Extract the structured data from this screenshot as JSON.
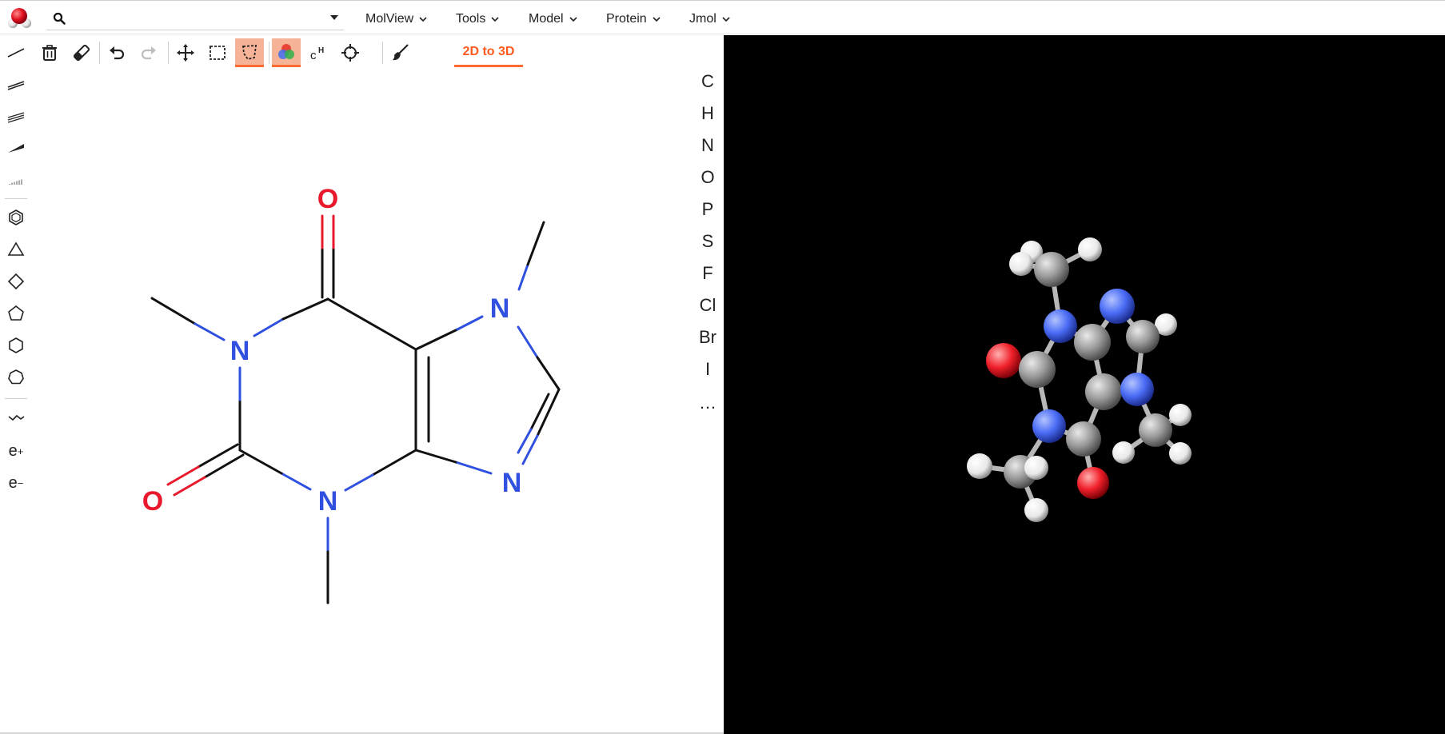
{
  "app": {
    "logo_icon": "molview-molecule-logo",
    "accent_color": "#ff5a1f"
  },
  "search": {
    "value": "",
    "placeholder": ""
  },
  "menus": [
    {
      "label": "MolView"
    },
    {
      "label": "Tools"
    },
    {
      "label": "Model"
    },
    {
      "label": "Protein"
    },
    {
      "label": "Jmol"
    }
  ],
  "toolbar": {
    "convert_label": "2D to 3D",
    "tools": [
      "trash-icon",
      "eraser-icon",
      "undo-icon",
      "redo-icon",
      "move-icon",
      "rect-select-icon",
      "lasso-select-icon",
      "color-mode-icon",
      "hydrogen-icon",
      "center-icon",
      "clean-icon"
    ],
    "active": [
      "lasso-select-icon",
      "color-mode-icon"
    ]
  },
  "left_tools": {
    "bonds": [
      "single-bond-icon",
      "double-bond-icon",
      "triple-bond-icon",
      "wedge-bond-icon",
      "hash-bond-icon"
    ],
    "rings": [
      "benzene-icon",
      "cyclopropane-icon",
      "cyclobutane-icon",
      "cyclopentane-icon",
      "cyclohexane-icon",
      "cycloheptane-icon"
    ],
    "misc": [
      "chain-icon"
    ],
    "charges": [
      {
        "base": "e",
        "sup": "+"
      },
      {
        "base": "e",
        "sup": "−"
      }
    ]
  },
  "elements": [
    "C",
    "H",
    "N",
    "O",
    "P",
    "S",
    "F",
    "Cl",
    "Br",
    "I",
    "…"
  ],
  "molecule_2d": {
    "atom_labels": [
      {
        "label": "O",
        "color": "#e8192c"
      },
      {
        "label": "N",
        "color": "#3050e0"
      },
      {
        "label": "N",
        "color": "#3050e0"
      },
      {
        "label": "O",
        "color": "#e8192c"
      },
      {
        "label": "N",
        "color": "#3050e0"
      },
      {
        "label": "N",
        "color": "#3050e0"
      }
    ],
    "colors": {
      "bond": "#111111",
      "nitrogen": "#3050e0",
      "oxygen": "#e8192c"
    }
  },
  "molecule_3d": {
    "background": "#000000",
    "colors": {
      "carbon": "#9a9a9a",
      "nitrogen": "#4a6cf5",
      "oxygen": "#f0202a",
      "hydrogen": "#f2f2f2"
    }
  }
}
